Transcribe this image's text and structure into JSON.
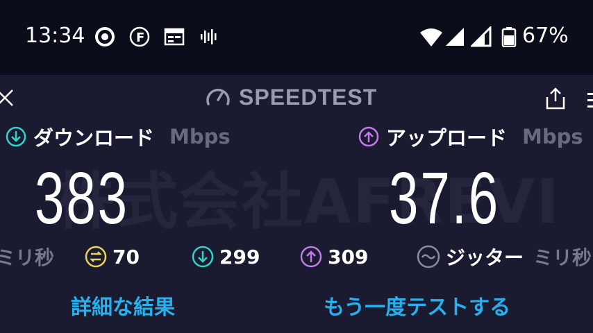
{
  "status_bar": {
    "time": "13:34",
    "battery": "67%",
    "icons": [
      "chrome-icon",
      "f-app-icon",
      "calendar-icon",
      "audio-wave-icon",
      "wifi-icon",
      "signal-icon",
      "signal-icon",
      "battery-icon"
    ]
  },
  "header": {
    "title": "SPEEDTEST",
    "icons": [
      "close-icon",
      "gauge-icon",
      "share-icon",
      "menu-icon"
    ]
  },
  "watermark": "株式会社AFREVI",
  "download": {
    "label": "ダウンロード",
    "unit": "Mbps",
    "value": "383"
  },
  "upload": {
    "label": "アップロード",
    "unit": "Mbps",
    "value": "37.6"
  },
  "stats": {
    "ping_unit_left": "ミリ秒",
    "ping_value": "70",
    "download_ping": "299",
    "upload_ping": "309",
    "jitter_label": "ジッター",
    "jitter_unit": "ミリ秒"
  },
  "actions": {
    "details": "詳細な結果",
    "retest": "もう一度テストする"
  },
  "colors": {
    "download_accent": "#2fd3c8",
    "upload_accent": "#c07be8",
    "ping_accent": "#f0d254",
    "link": "#26b1ee"
  }
}
